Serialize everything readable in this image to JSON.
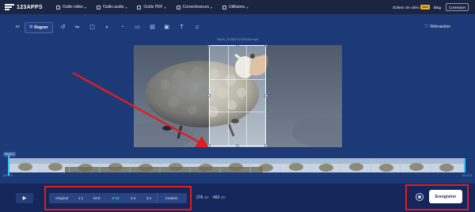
{
  "app": {
    "logo_text": "123APPS",
    "nav": [
      {
        "label": "Outils vidéo",
        "icon": "video-icon"
      },
      {
        "label": "Outils audio",
        "icon": "audio-icon"
      },
      {
        "label": "Outils PDF",
        "icon": "pdf-icon"
      },
      {
        "label": "Convertisseurs",
        "icon": "convert-icon"
      },
      {
        "label": "Utilitaires",
        "icon": "utilities-icon"
      }
    ],
    "editor_link": "Éditeur de vidéo",
    "new_badge": "New",
    "blog_link": "Blog",
    "connect_button": "Connexion"
  },
  "toolbar": {
    "crop_label": "Rogner",
    "feedback_label": "Rétroaction",
    "tools": [
      "scissors-icon",
      "crop-icon",
      "rotate-icon",
      "flip-icon",
      "resize-icon",
      "filter-icon",
      "speed-icon",
      "subtitle-icon",
      "text-icon",
      "image-icon",
      "text-style-icon",
      "audio-icon"
    ]
  },
  "stage": {
    "filename": "Video_20230712155016.mp4"
  },
  "timeline": {
    "current_time": "00:00.0",
    "start_time": "00:00.0",
    "end_time": "00:22.5"
  },
  "bottom": {
    "ratios": [
      "Original",
      "1:1",
      "16:9",
      "9:16",
      "4:3",
      "3:4",
      "Custom"
    ],
    "active_ratio": "9:16",
    "width": "276",
    "height": "492",
    "px_unit": "px",
    "save_button": "Enregistrer"
  },
  "colors": {
    "background": "#1d3a78",
    "accent_active": "#35d3a4",
    "highlight_box": "#e11d1d",
    "timeline_edge": "#39c2f5"
  }
}
